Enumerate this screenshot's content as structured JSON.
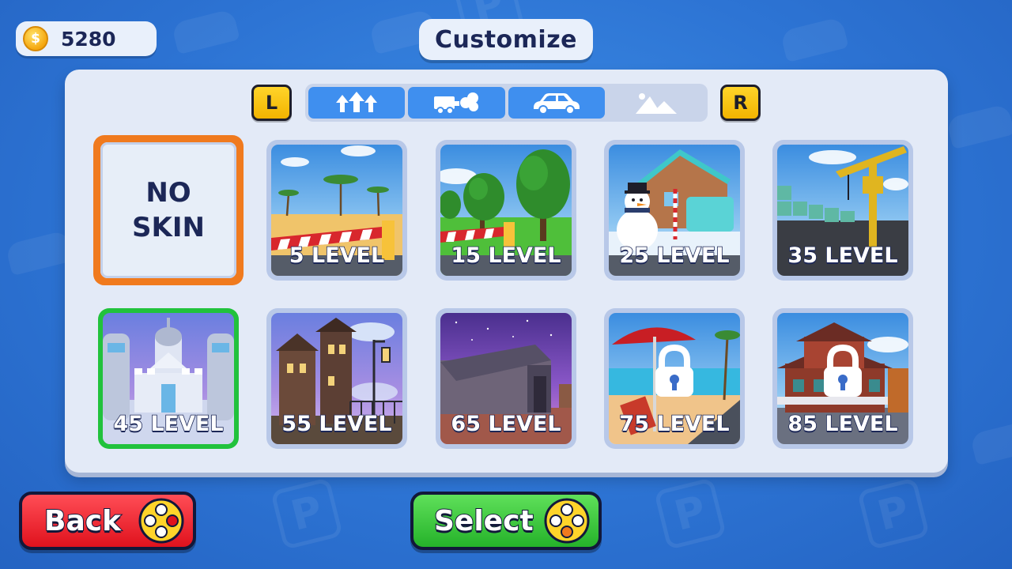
{
  "header": {
    "coins": "5280",
    "coin_symbol": "$",
    "title": "Customize"
  },
  "nav": {
    "left_key": "L",
    "right_key": "R"
  },
  "tabs": [
    {
      "icon": "arrows-up-icon",
      "active": false
    },
    {
      "icon": "exhaust-smoke-icon",
      "active": false
    },
    {
      "icon": "car-icon",
      "active": false
    },
    {
      "icon": "mountains-icon",
      "active": true
    }
  ],
  "skins": [
    {
      "id": "no-skin",
      "label": "NO\nSKIN",
      "selected": true
    },
    {
      "id": "desert",
      "label": "5 LEVEL"
    },
    {
      "id": "forest",
      "label": "15 LEVEL"
    },
    {
      "id": "winter",
      "label": "25 LEVEL"
    },
    {
      "id": "construction",
      "label": "35 LEVEL"
    },
    {
      "id": "ice-castle",
      "label": "45 LEVEL",
      "equipped": true
    },
    {
      "id": "haunted",
      "label": "55 LEVEL"
    },
    {
      "id": "night-tunnel",
      "label": "65 LEVEL"
    },
    {
      "id": "beach",
      "label": "75 LEVEL",
      "locked": true
    },
    {
      "id": "pagoda",
      "label": "85 LEVEL",
      "locked": true
    }
  ],
  "buttons": {
    "back": "Back",
    "select": "Select"
  },
  "colors": {
    "selected_border": "#f07a1e",
    "equipped_border": "#21c23c",
    "back": "#e0121d",
    "select": "#25b22a"
  }
}
